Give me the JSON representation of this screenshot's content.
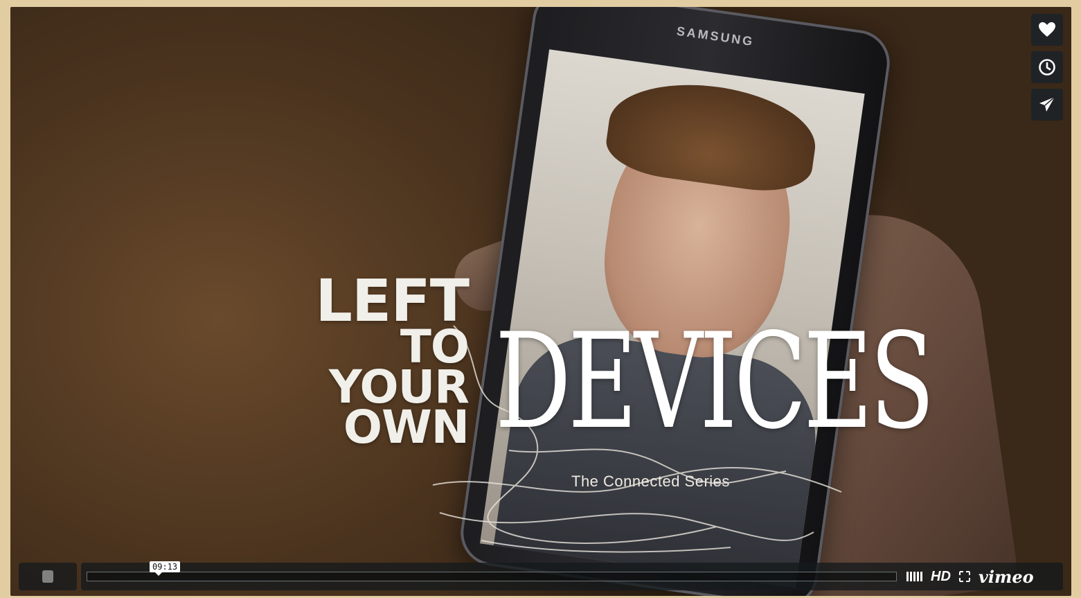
{
  "video": {
    "title_line1": "LEFT",
    "title_line2": "TO",
    "title_line3": "YOUR",
    "title_line4": "OWN",
    "title_main": "DEVICES",
    "subtitle": "The Connected Series",
    "phone_brand": "SAMSUNG"
  },
  "side_buttons": [
    {
      "icon": "heart-icon"
    },
    {
      "icon": "clock-icon"
    },
    {
      "icon": "paper-plane-icon"
    }
  ],
  "controls": {
    "time_tooltip": "09:13",
    "progress_fraction": 0,
    "hd_label": "HD",
    "brand_label": "vimeo"
  },
  "colors": {
    "accent": "#1ab7ea",
    "control_bg": "#1f2326",
    "frame": "#e2cda3"
  }
}
